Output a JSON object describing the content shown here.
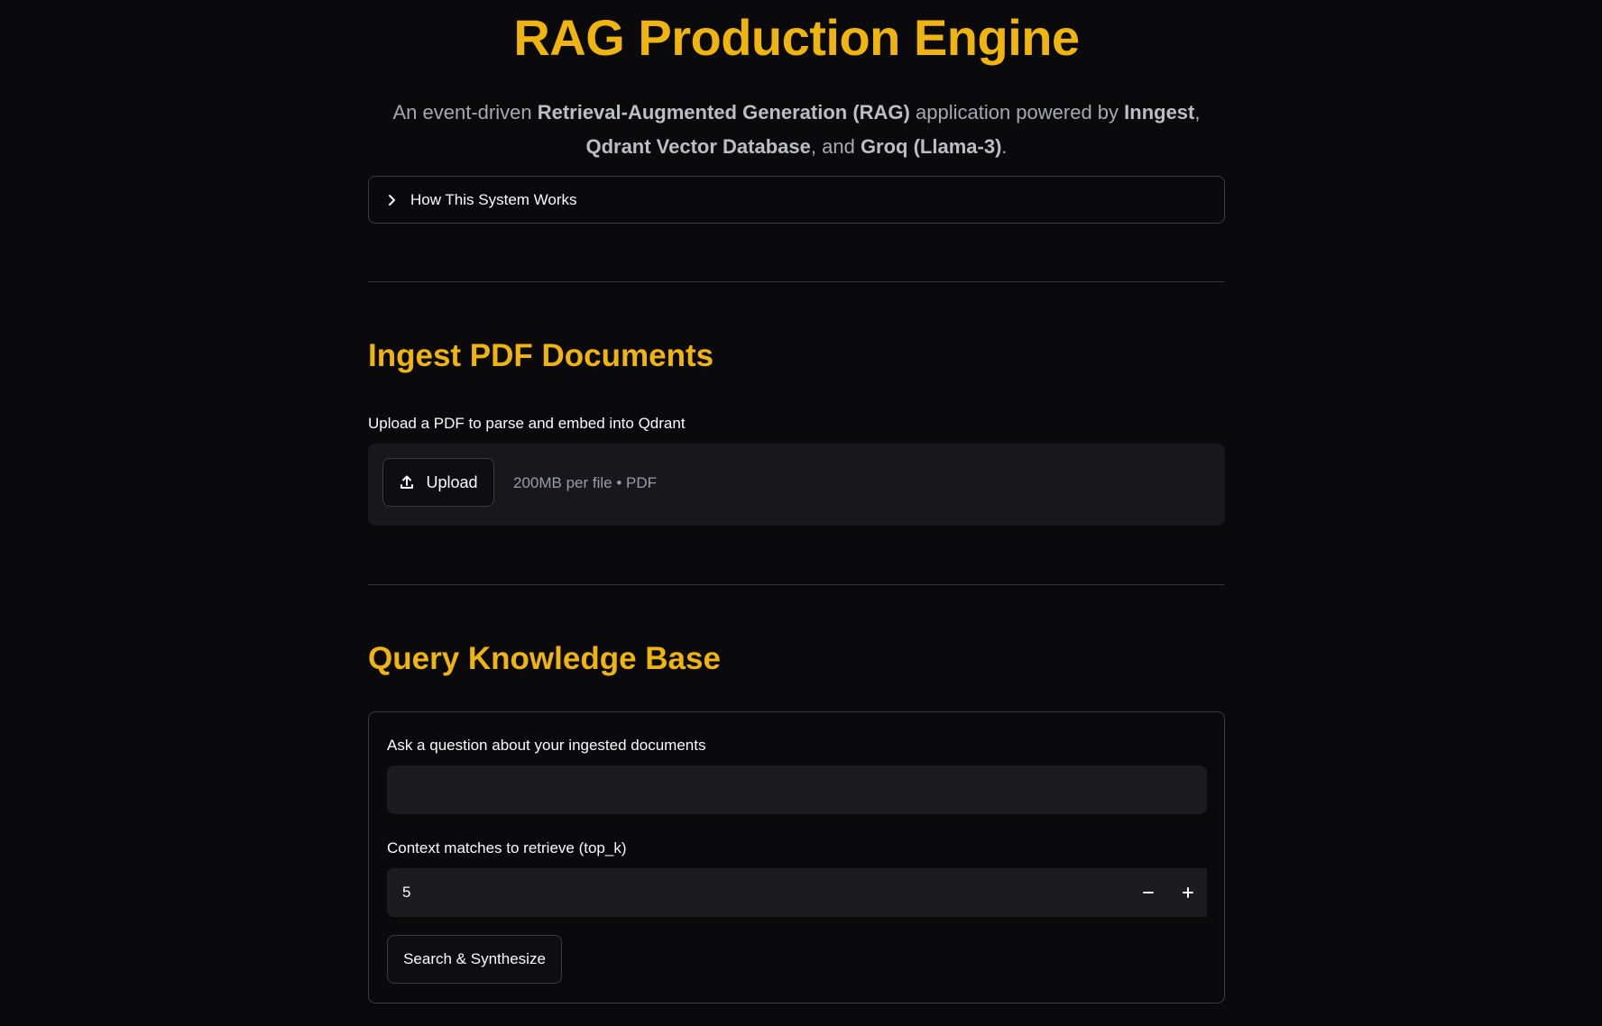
{
  "header": {
    "title": "RAG Production Engine",
    "subtitle": [
      {
        "text": "An event-driven ",
        "bold": false
      },
      {
        "text": "Retrieval-Augmented Generation (RAG)",
        "bold": true
      },
      {
        "text": " application powered by ",
        "bold": false
      },
      {
        "text": "Inngest",
        "bold": true
      },
      {
        "text": ",",
        "bold": false
      },
      {
        "text": "Qdrant Vector Database",
        "bold": true
      },
      {
        "text": ", and ",
        "bold": false
      },
      {
        "text": "Groq (Llama-3)",
        "bold": true
      },
      {
        "text": ".",
        "bold": false
      }
    ]
  },
  "expander": {
    "label": "How This System Works",
    "icon": "chevron-right-icon"
  },
  "ingest": {
    "heading": "Ingest PDF Documents",
    "uploader_label": "Upload a PDF to parse and embed into Qdrant",
    "upload_button": "Upload",
    "upload_icon": "upload-icon",
    "hint": "200MB per file • PDF"
  },
  "query": {
    "heading": "Query Knowledge Base",
    "question_label": "Ask a question about your ingested documents",
    "question_value": "",
    "topk_label": "Context matches to retrieve (top_k)",
    "topk_value": "5",
    "submit_label": "Search & Synthesize"
  },
  "colors": {
    "background": "#0a0a0c",
    "accent": "#f0b40f",
    "input_bg": "#1c1c20",
    "border": "#3a3b40"
  }
}
